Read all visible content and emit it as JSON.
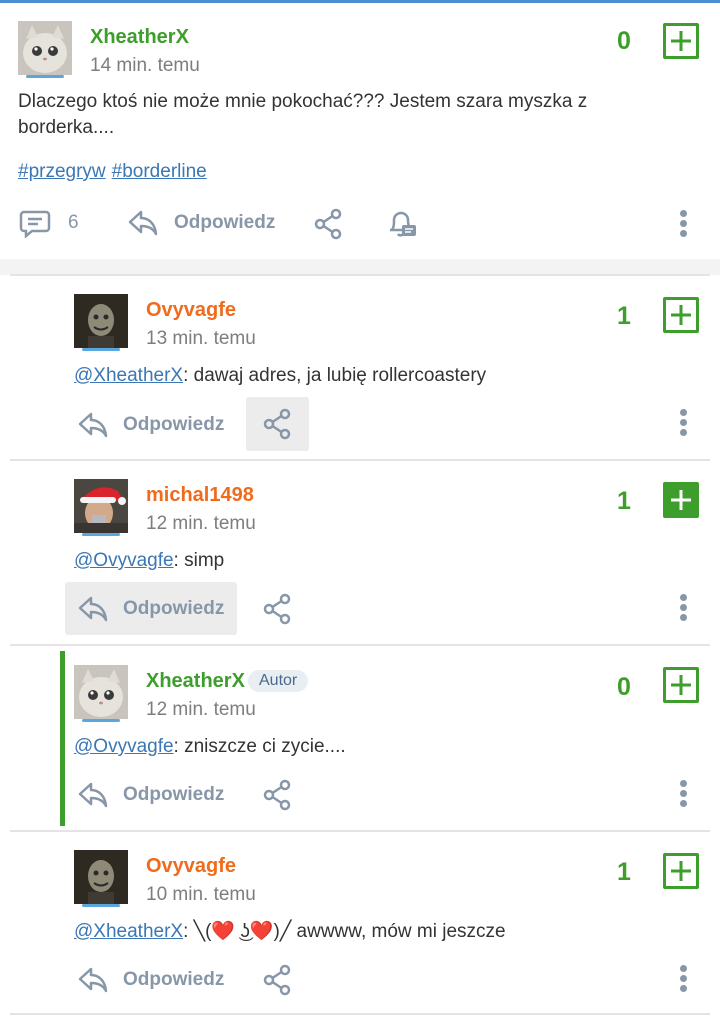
{
  "main_post": {
    "author": "XheatherX",
    "time": "14 min. temu",
    "votes": "0",
    "text": "Dlaczego ktoś nie może mnie pokochać??? Jestem szara myszka z borderka....",
    "tags": [
      "#przegryw",
      "#borderline"
    ],
    "comment_count": "6",
    "reply_label": "Odpowiedz"
  },
  "comments": [
    {
      "author": "Ovyvagfe",
      "time": "13 min. temu",
      "votes": "1",
      "mention": "@XheatherX",
      "text": ": dawaj adres, ja lubię rollercoastery",
      "reply_label": "Odpowiedz"
    },
    {
      "author": "michal1498",
      "time": "12 min. temu",
      "votes": "1",
      "mention": "@Ovyvagfe",
      "text": ": simp",
      "reply_label": "Odpowiedz"
    },
    {
      "author": "XheatherX",
      "badge": "Autor",
      "time": "12 min. temu",
      "votes": "0",
      "mention": "@Ovyvagfe",
      "text": ": zniszcze ci zycie....",
      "reply_label": "Odpowiedz"
    },
    {
      "author": "Ovyvagfe",
      "time": "10 min. temu",
      "votes": "1",
      "mention": "@XheatherX",
      "text": ":  ╲(❤️ ͜ʖ❤️)╱ awwww, mów mi jeszcze",
      "reply_label": "Odpowiedz"
    }
  ],
  "colors": {
    "accent_green": "#3e9e2c",
    "orange_user": "#f06b1c",
    "link_blue": "#3a77b4",
    "icon_gray": "#8797a8"
  },
  "icons": [
    "comments-icon",
    "reply-icon",
    "share-icon",
    "bell-icon",
    "more-icon",
    "plus-icon"
  ]
}
